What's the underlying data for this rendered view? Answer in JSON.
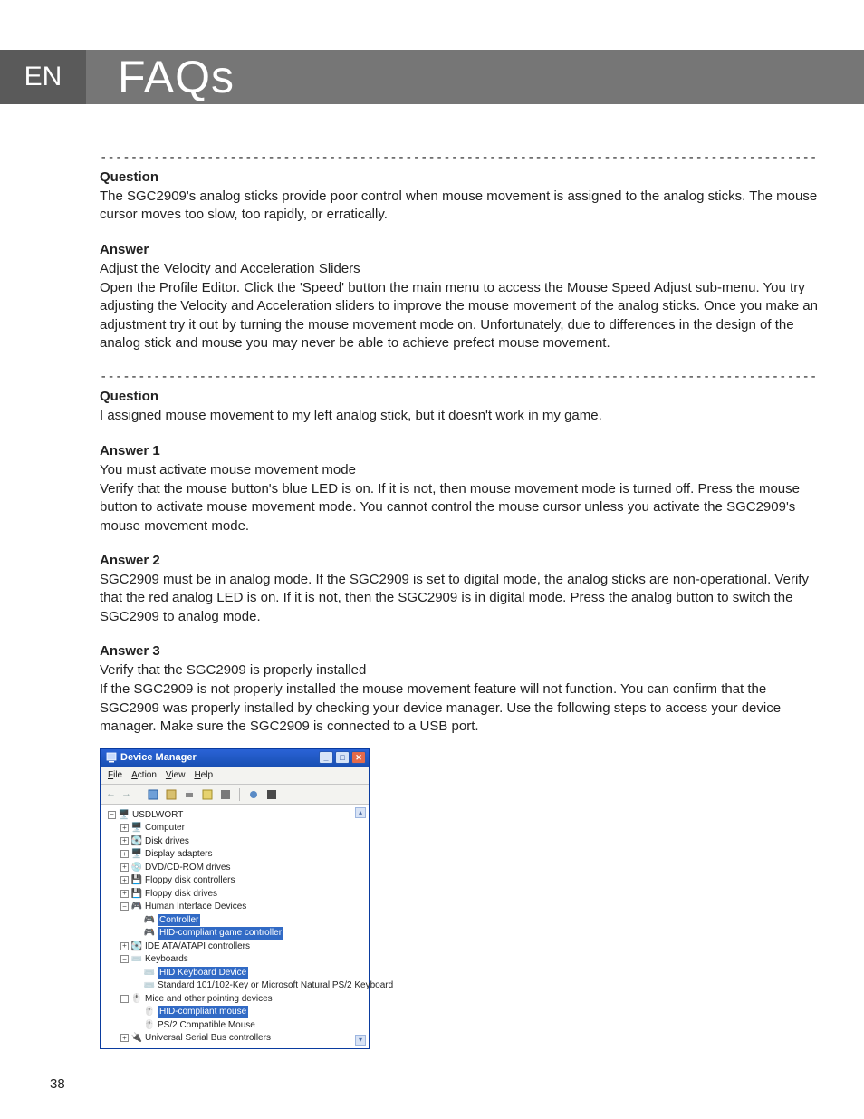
{
  "header": {
    "lang": "EN",
    "title": "FAQs"
  },
  "page_number": "38",
  "separator": "----------------------------------------------------------------------------------------------------------------",
  "faq1": {
    "q_heading": "Question",
    "q_text": "The SGC2909's analog sticks provide poor control when mouse movement is assigned to the analog sticks. The mouse cursor moves too slow, too rapidly, or erratically.",
    "a_heading": "Answer",
    "a_line1": "Adjust the Velocity and Acceleration Sliders",
    "a_text": "Open the Profile Editor. Click the 'Speed' button the main menu to access the Mouse Speed Adjust sub-menu. You try adjusting the Velocity and Acceleration sliders to improve the mouse movement of the analog sticks. Once you make an adjustment try it out by turning the mouse movement mode on. Unfortunately, due to differences in the design of the analog stick and mouse you may never be able to achieve prefect mouse movement."
  },
  "faq2": {
    "q_heading": "Question",
    "q_text": "I assigned mouse movement to my left analog stick, but it doesn't work in my game.",
    "a1_heading": "Answer 1",
    "a1_line1": "You must activate mouse movement mode",
    "a1_text": "Verify that the mouse button's blue LED is on. If it is not, then mouse movement mode is turned off. Press the mouse button to activate mouse movement mode. You cannot control the mouse cursor unless you activate the SGC2909's mouse movement mode.",
    "a2_heading": "Answer 2",
    "a2_text": "SGC2909 must be in analog mode. If the SGC2909 is set to digital mode, the analog sticks are non-operational. Verify that the red analog LED is on. If it is not, then the SGC2909 is in digital mode. Press the analog button to switch the SGC2909 to analog mode.",
    "a3_heading": "Answer 3",
    "a3_line1": "Verify that the SGC2909 is properly installed",
    "a3_text": "If the SGC2909 is not properly installed the mouse movement feature will not function. You can confirm that the SGC2909 was properly installed by checking your device manager. Use the following steps to access your device manager. Make sure the SGC2909 is connected to a USB port."
  },
  "dm": {
    "title": "Device Manager",
    "menu": {
      "file": "File",
      "action": "Action",
      "view": "View",
      "help": "Help"
    },
    "tree": {
      "root": "USDLWORT",
      "computer": "Computer",
      "disk": "Disk drives",
      "display": "Display adapters",
      "dvd": "DVD/CD-ROM drives",
      "floppyc": "Floppy disk controllers",
      "floppyd": "Floppy disk drives",
      "hid": "Human Interface Devices",
      "hid_controller": "Controller",
      "hid_game": "HID-compliant game controller",
      "ide": "IDE ATA/ATAPI controllers",
      "keyboards": "Keyboards",
      "kbd_hid": "HID Keyboard Device",
      "kbd_std": "Standard 101/102-Key or Microsoft Natural PS/2 Keyboard",
      "mice": "Mice and other pointing devices",
      "mice_hid": "HID-compliant mouse",
      "mice_ps2": "PS/2 Compatible Mouse",
      "usb": "Universal Serial Bus controllers"
    }
  }
}
